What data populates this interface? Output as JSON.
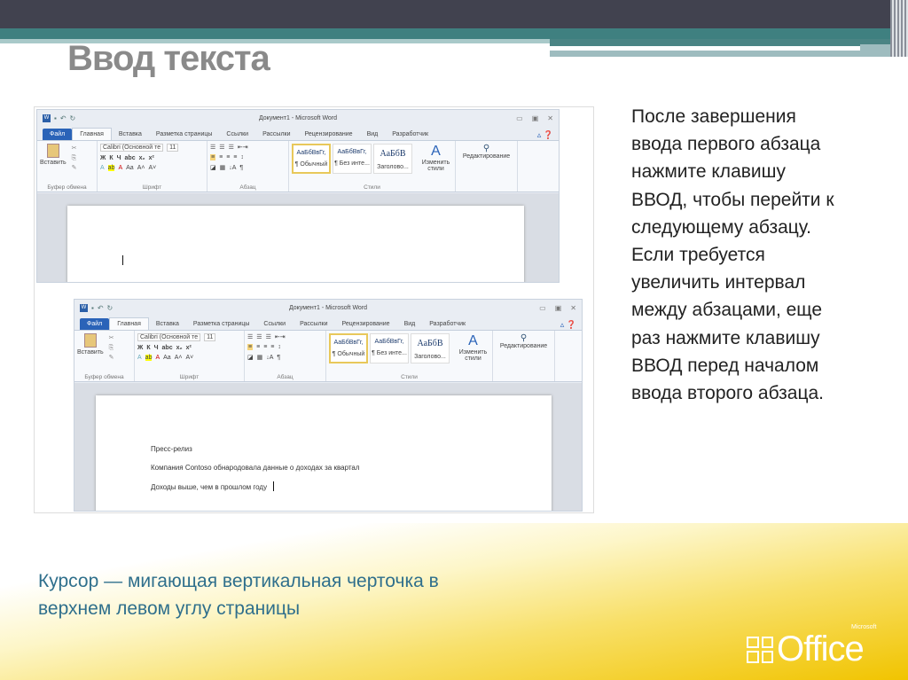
{
  "slide": {
    "title": "Ввод текста",
    "body": [
      "После завершения",
      "ввода первого абзаца",
      "нажмите клавишу",
      "ВВОД, чтобы перейти к",
      "следующему абзацу.",
      "Если требуется",
      "увеличить интервал",
      "между абзацами, еще",
      "раз нажмите клавишу",
      "ВВОД перед началом",
      "ввода второго абзаца."
    ],
    "caption": [
      "Курсор — мигающая вертикальная черточка в",
      "верхнем левом углу страницы"
    ],
    "logo": {
      "word": "Office",
      "brand": "Microsoft"
    }
  },
  "word": {
    "title": "Документ1 - Microsoft Word",
    "tabs": [
      "Файл",
      "Главная",
      "Вставка",
      "Разметка страницы",
      "Ссылки",
      "Рассылки",
      "Рецензирование",
      "Вид",
      "Разработчик"
    ],
    "paste": "Вставить",
    "clipboard": "Буфер обмена",
    "font_name": "Calibri (Основной те",
    "font_size": "11",
    "font_group": "Шрифт",
    "para_group": "Абзац",
    "styles": [
      {
        "sample": "АаБбВвГг,",
        "name": "¶ Обычный"
      },
      {
        "sample": "АаБбВвГг,",
        "name": "¶ Без инте..."
      },
      {
        "sample": "АаБбВ",
        "name": "Заголово..."
      }
    ],
    "change_styles": "Изменить стили",
    "styles_group": "Стили",
    "editing": "Редактирование"
  },
  "doc2": {
    "lines": [
      "Пресс-релиз",
      "Компания Contoso обнародовала данные о доходах за квартал",
      "Доходы выше, чем в прошлом году"
    ]
  },
  "colors": {
    "file_tab": "#2a63b8",
    "caption": "#2f6f8c",
    "topbar": "#41424f",
    "teal": "#3f8080"
  }
}
